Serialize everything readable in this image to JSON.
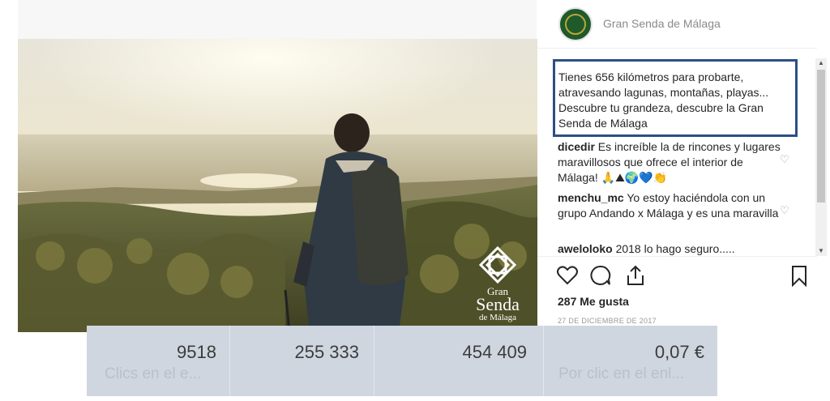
{
  "post": {
    "account_name": "Gran Senda de Málaga",
    "logo_text": [
      "Gran",
      "Senda",
      "de Málaga"
    ],
    "caption": "Tienes 656 kilómetros para probarte, atravesando lagunas, montañas, playas... Descubre tu grandeza, descubre la Gran Senda de Málaga",
    "comments": [
      {
        "user": "dicedir",
        "text": "Es increíble la de rincones y lugares maravillosos que ofrece el interior de Málaga! 🙏⛰🌍💙👏"
      },
      {
        "user": "menchu_mc",
        "text": "Yo estoy haciéndola con un grupo Andando x Málaga y es una maravilla"
      },
      {
        "user": "aweloloko",
        "text": "2018 lo hago seguro....."
      }
    ],
    "likes": "287 Me gusta",
    "date": "27 DE DICIEMBRE DE 2017"
  },
  "stats": [
    {
      "value": "9518",
      "label": "Clics en el e..."
    },
    {
      "value": "255 333",
      "label": ""
    },
    {
      "value": "454 409",
      "label": ""
    },
    {
      "value": "0,07 €",
      "label": "Por clic en el enl..."
    }
  ],
  "icons": {
    "like": "heart-icon",
    "comment": "comment-icon",
    "share": "share-icon",
    "save": "bookmark-icon",
    "comment_like": "heart-icon"
  },
  "colors": {
    "caption_border": "#2c4e86",
    "avatar_bg": "#1f5a2a",
    "stats_bg": "#cfd6e0"
  }
}
